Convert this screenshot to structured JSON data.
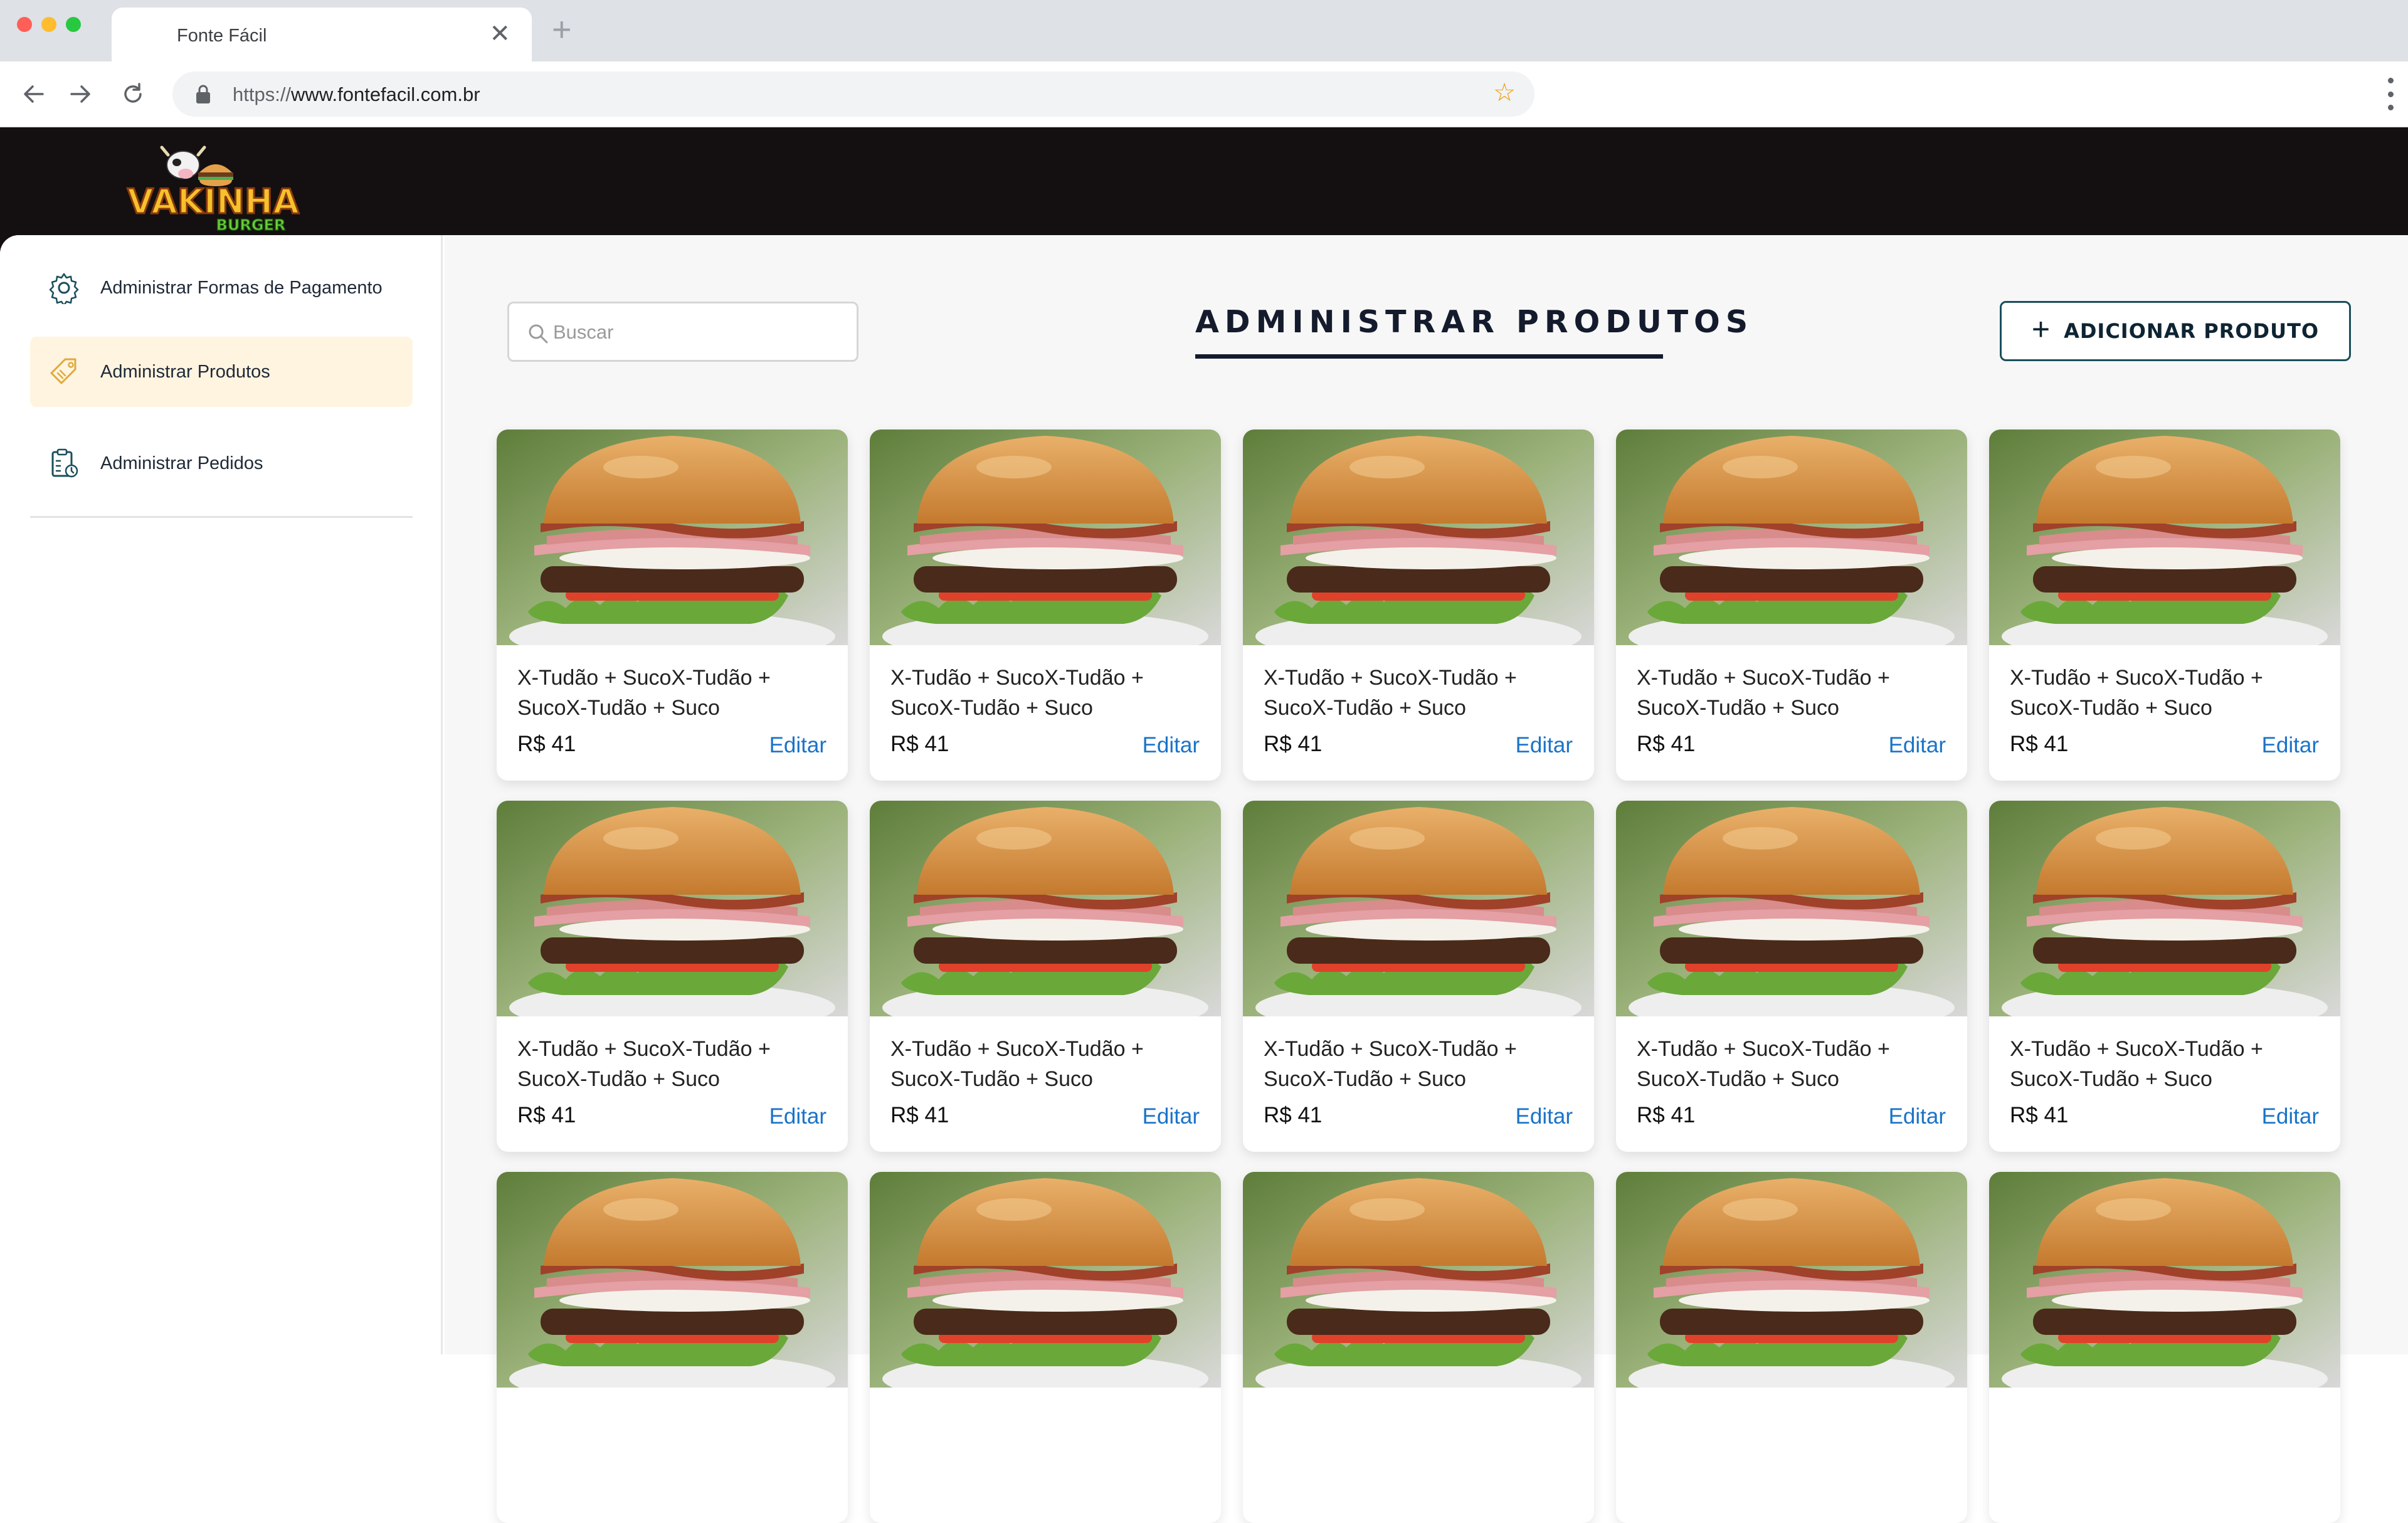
{
  "browser": {
    "tab_title": "Fonte Fácil",
    "url_scheme": "https://",
    "url_host": "www.fontefacil.com.br",
    "icons": [
      "back-icon",
      "forward-icon",
      "reload-icon",
      "lock-icon",
      "star-icon",
      "menu-icon",
      "close-icon",
      "new-tab-icon"
    ]
  },
  "brand": {
    "logo_text": "VAKINHA",
    "logo_subtext": "BURGER",
    "header_color": "#140f10"
  },
  "sidebar": {
    "items": [
      {
        "label": "Administrar Formas de Pagamento",
        "icon": "gear-icon",
        "active": false
      },
      {
        "label": "Administrar Produtos",
        "icon": "tag-icon",
        "active": true
      },
      {
        "label": "Administrar Pedidos",
        "icon": "clipboard-icon",
        "active": false
      }
    ]
  },
  "main": {
    "search_placeholder": "Buscar",
    "title": "ADMINISTRAR PRODUTOS",
    "add_button_label": "ADICIONAR PRODUTO",
    "accent_color": "#1a4f5c",
    "link_color": "#1a73c8"
  },
  "products": [
    {
      "name": "X-Tudão + SucoX-Tudão + SucoX-Tudão + Suco",
      "price": "R$ 41",
      "action": "Editar"
    },
    {
      "name": "X-Tudão + SucoX-Tudão + SucoX-Tudão + Suco",
      "price": "R$ 41",
      "action": "Editar"
    },
    {
      "name": "X-Tudão + SucoX-Tudão + SucoX-Tudão + Suco",
      "price": "R$ 41",
      "action": "Editar"
    },
    {
      "name": "X-Tudão + SucoX-Tudão + SucoX-Tudão + Suco",
      "price": "R$ 41",
      "action": "Editar"
    },
    {
      "name": "X-Tudão + SucoX-Tudão + SucoX-Tudão + Suco",
      "price": "R$ 41",
      "action": "Editar"
    },
    {
      "name": "X-Tudão + SucoX-Tudão + SucoX-Tudão + Suco",
      "price": "R$ 41",
      "action": "Editar"
    },
    {
      "name": "X-Tudão + SucoX-Tudão + SucoX-Tudão + Suco",
      "price": "R$ 41",
      "action": "Editar"
    },
    {
      "name": "X-Tudão + SucoX-Tudão + SucoX-Tudão + Suco",
      "price": "R$ 41",
      "action": "Editar"
    },
    {
      "name": "X-Tudão + SucoX-Tudão + SucoX-Tudão + Suco",
      "price": "R$ 41",
      "action": "Editar"
    },
    {
      "name": "X-Tudão + SucoX-Tudão + SucoX-Tudão + Suco",
      "price": "R$ 41",
      "action": "Editar"
    },
    {
      "name": "",
      "price": "",
      "action": ""
    },
    {
      "name": "",
      "price": "",
      "action": ""
    },
    {
      "name": "",
      "price": "",
      "action": ""
    },
    {
      "name": "",
      "price": "",
      "action": ""
    },
    {
      "name": "",
      "price": "",
      "action": ""
    }
  ]
}
